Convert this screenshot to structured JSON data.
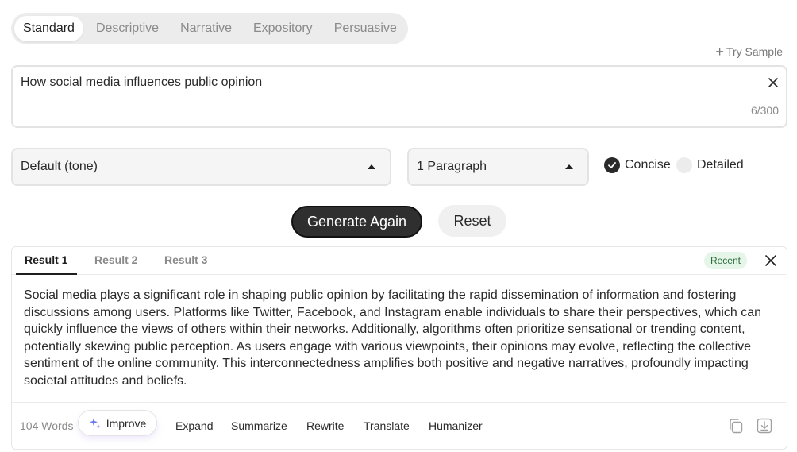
{
  "tabs": [
    {
      "label": "Standard",
      "active": true
    },
    {
      "label": "Descriptive",
      "active": false
    },
    {
      "label": "Narrative",
      "active": false
    },
    {
      "label": "Expository",
      "active": false
    },
    {
      "label": "Persuasive",
      "active": false
    }
  ],
  "try_sample": {
    "label": "Try Sample",
    "icon": "plus-icon"
  },
  "topic": {
    "value": "How social media influences public opinion",
    "counter": "6/300",
    "clear_icon": "close-icon"
  },
  "options": {
    "tone": "Default (tone)",
    "length": "1 Paragraph",
    "concise_label": "Concise",
    "detailed_label": "Detailed",
    "selected_mode": "Concise"
  },
  "actions": {
    "generate_label": "Generate Again",
    "reset_label": "Reset"
  },
  "result": {
    "tabs": [
      "Result 1",
      "Result 2",
      "Result 3"
    ],
    "active_tab": "Result 1",
    "badge": "Recent",
    "text": "Social media plays a significant role in shaping public opinion by facilitating the rapid dissemination of information and fostering discussions among users. Platforms like Twitter, Facebook, and Instagram enable individuals to share their perspectives, which can quickly influence the views of others within their networks. Additionally, algorithms often prioritize sensational or trending content, potentially skewing public perception. As users engage with various viewpoints, their opinions may evolve, reflecting the collective sentiment of the online community. This interconnectedness amplifies both positive and negative narratives, profoundly impacting societal attitudes and beliefs.",
    "word_count": "104 Words",
    "improve_label": "Improve",
    "footer_actions": [
      "Expand",
      "Summarize",
      "Rewrite",
      "Translate",
      "Humanizer"
    ]
  },
  "colors": {
    "primary_button": "#2f2f2f",
    "badge_bg": "#e5f6e9",
    "badge_text": "#2e6b3e"
  }
}
